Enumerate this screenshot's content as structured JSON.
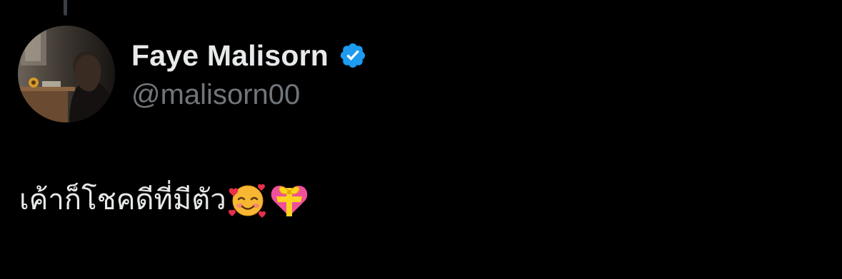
{
  "tweet": {
    "author": {
      "display_name": "Faye Malisorn",
      "handle": "@malisorn00",
      "verified": true,
      "verified_icon": "verified-badge-icon",
      "verified_color": "#1d9bf0"
    },
    "text": "เค้าก็โชคดีที่มีตัว",
    "emojis": [
      "smiling-face-with-hearts-icon",
      "heart-with-ribbon-icon"
    ]
  },
  "colors": {
    "background": "#000000",
    "primary_text": "#e7e9ea",
    "secondary_text": "#71767b",
    "thread_line": "#3a3f44"
  }
}
